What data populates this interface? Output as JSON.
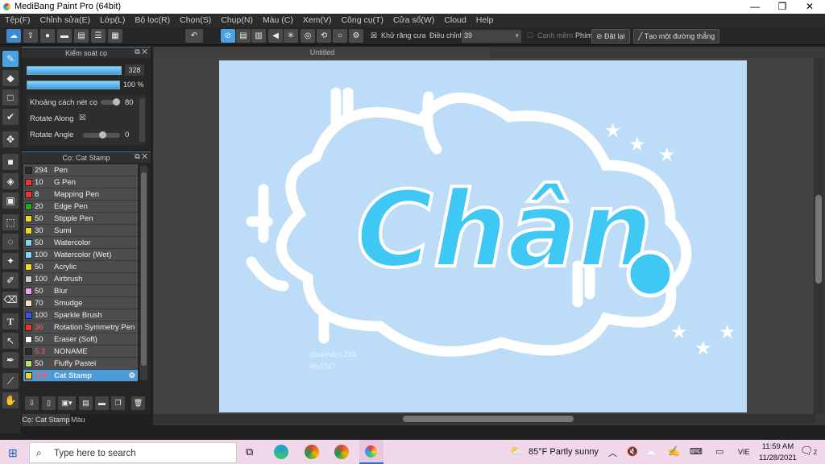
{
  "window": {
    "title": "MediBang Paint Pro (64bit)",
    "minimize": "—",
    "maximize": "❐",
    "close": "✕"
  },
  "menu": [
    "Tệp(F)",
    "Chỉnh sửa(E)",
    "Lớp(L)",
    "Bộ lọc(R)",
    "Chọn(S)",
    "Chụp(N)",
    "Màu (C)",
    "Xem(V)",
    "Công cụ(T)",
    "Cửa sổ(W)",
    "Cloud",
    "Help"
  ],
  "toolbar": {
    "antialias": "Khử răng cưa",
    "correction_label": "Điều chỉnh",
    "correction_value": "39",
    "soft_edge": "Cạnh mềm",
    "key_label": "Phím",
    "reset": "Đặt lại",
    "straight_line": "Tạo một đường thẳng"
  },
  "brush_control": {
    "title": "Kiểm soát cọ",
    "size": "328",
    "opacity": "100 %",
    "spacing_label": "Khoảng cách nét cọ",
    "spacing_value": "80",
    "rotate_along": "Rotate Along",
    "rotate_angle": "Rotate Angle",
    "rotate_angle_value": "0"
  },
  "brush_list": {
    "title": "Cọ: Cat Stamp",
    "items": [
      {
        "size": "294",
        "name": "Pen",
        "color": "#2a2a2a"
      },
      {
        "size": "10",
        "name": "G Pen",
        "color": "#ee3333"
      },
      {
        "size": "8",
        "name": "Mapping Pen",
        "color": "#ee3333"
      },
      {
        "size": "20",
        "name": "Edge Pen",
        "color": "#22aa22"
      },
      {
        "size": "50",
        "name": "Stipple Pen",
        "color": "#eed820"
      },
      {
        "size": "30",
        "name": "Sumi",
        "color": "#eed820"
      },
      {
        "size": "50",
        "name": "Watercolor",
        "color": "#7fd8f8"
      },
      {
        "size": "100",
        "name": "Watercolor (Wet)",
        "color": "#7fd8f8"
      },
      {
        "size": "50",
        "name": "Acrylic",
        "color": "#eed820"
      },
      {
        "size": "100",
        "name": "Airbrush",
        "color": "#cccccc"
      },
      {
        "size": "50",
        "name": "Blur",
        "color": "#f0a0f0"
      },
      {
        "size": "70",
        "name": "Smudge",
        "color": "#f8dcc8"
      },
      {
        "size": "100",
        "name": "Sparkle Brush",
        "color": "#3355ee"
      },
      {
        "size": "36",
        "name": "Rotation Symmetry Pen",
        "color": "#ee3333",
        "red": true
      },
      {
        "size": "50",
        "name": "Eraser (Soft)",
        "color": "#ffffff"
      },
      {
        "size": "5.3",
        "name": "NONAME",
        "color": "#2a2a2a",
        "red": true
      },
      {
        "size": "50",
        "name": "Fluffy Pastel",
        "color": "#b8e070"
      },
      {
        "size": "328",
        "name": "Cat Stamp",
        "color": "#eed820",
        "red": true,
        "selected": true
      }
    ]
  },
  "bottom_tabs": [
    "Cọ: Cat Stamp",
    "Màu"
  ],
  "document": {
    "tab": "Untitled",
    "artwork_text": "Chân",
    "credit1": "chaenday208",
    "credit2": "#hd247"
  },
  "taskbar": {
    "search_placeholder": "Type here to search",
    "weather": "85°F  Partly sunny",
    "lang": "VIE",
    "time": "11:59 AM",
    "date": "11/28/2021",
    "notifications": "2"
  }
}
